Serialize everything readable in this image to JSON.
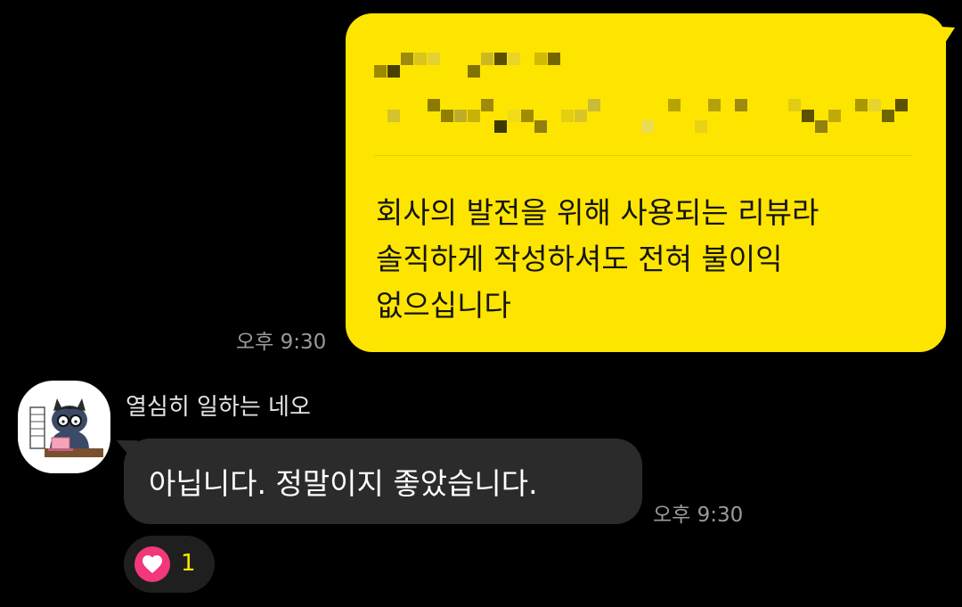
{
  "colors": {
    "background": "#000000",
    "outgoing_bubble": "#fee500",
    "incoming_bubble": "#2b2b2b",
    "reaction_heart": "#f2377a",
    "reaction_count": "#fee500",
    "timestamp": "#9a9a9a"
  },
  "outgoing_message": {
    "redacted_preview": "pixelated (obscured) text",
    "text": "회사의 발전을 위해 사용되는 리뷰라\n솔직하게 작성하셔도 전혀 불이익\n없으십니다",
    "time": "오후 9:30"
  },
  "incoming_message": {
    "sender_name": "열심히 일하는 네오",
    "avatar_icon": "cat-character-at-laptop-avatar",
    "text": "아닙니다. 정말이지 좋았습니다.",
    "time": "오후 9:30",
    "reaction": {
      "icon": "heart-icon",
      "count": "1"
    }
  }
}
